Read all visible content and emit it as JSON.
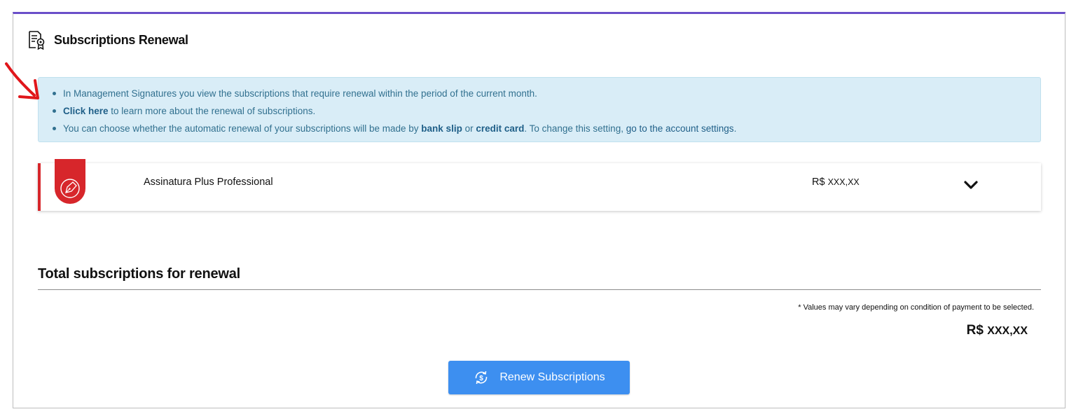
{
  "header": {
    "title": "Subscriptions Renewal",
    "icon": "certificate-document-icon"
  },
  "info": {
    "line1": "In Management Signatures you view the subscriptions that require renewal within the period of the current month.",
    "line2_link": "Click here",
    "line2_rest": " to learn more about the renewal of subscriptions.",
    "line3_part1": "You can choose whether the automatic renewal of your subscriptions will be made by ",
    "line3_bank_slip": "bank slip",
    "line3_or": " or ",
    "line3_credit_card": "credit card",
    "line3_part2": ". To change this setting, ",
    "line3_link": "go to the account settings",
    "line3_end": "."
  },
  "subscription": {
    "name": "Assinatura Plus Professional",
    "currency": "R$",
    "price": "XXX,XX",
    "icon": "pen-nib-icon",
    "accent_color": "#d7262b"
  },
  "total": {
    "title": "Total subscriptions for renewal",
    "note": "* Values may vary depending on condition of payment to be selected.",
    "currency": "R$",
    "value": "XXX,XX"
  },
  "button": {
    "label": "Renew Subscriptions",
    "icon": "dollar-refresh-icon",
    "color": "#3d8ff0"
  },
  "colors": {
    "panel_top_border": "#6a4fc9",
    "info_bg": "#d9edf7",
    "info_text": "#31708f",
    "annotation_arrow": "#e0161b"
  }
}
